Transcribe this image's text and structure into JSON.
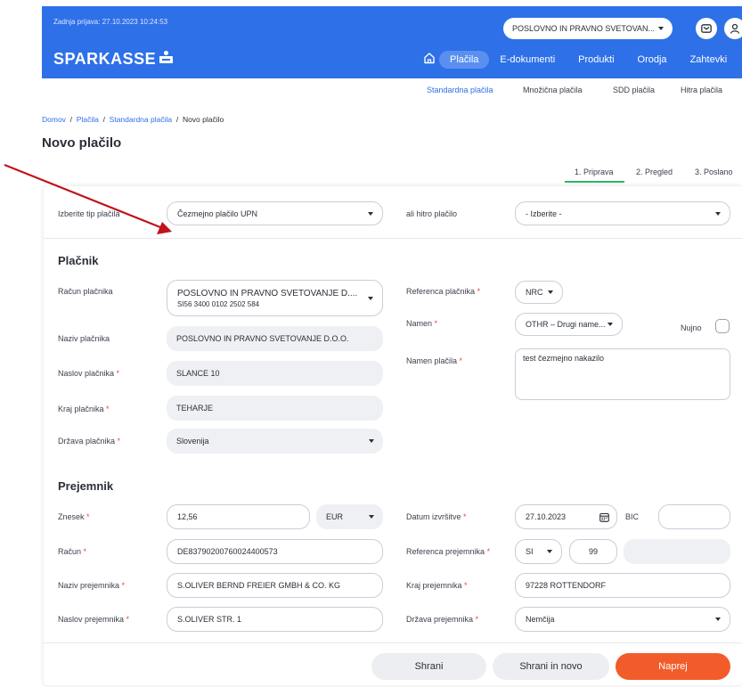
{
  "header": {
    "last_login": "Zadnja prijava: 27.10.2023 10:24:53",
    "logo": "SPARKASSE",
    "company_select": "POSLOVNO IN PRAVNO SVETOVAN...",
    "nav": [
      "Plačila",
      "E-dokumenti",
      "Produkti",
      "Orodja",
      "Zahtevki"
    ],
    "active_nav": "Plačila"
  },
  "subnav": [
    "Standardna plačila",
    "Množična plačila",
    "SDD plačila",
    "Hitra plačila"
  ],
  "breadcrumb": {
    "home": "Domov",
    "p1": "Plačila",
    "p2": "Standardna plačila",
    "current": "Novo plačilo",
    "sep": "/"
  },
  "page_title": "Novo plačilo",
  "steps": [
    "1. Priprava",
    "2. Pregled",
    "3. Poslano"
  ],
  "type_row": {
    "label": "Izberite tip plačila",
    "value": "Čezmejno plačilo UPN",
    "quick_label": "ali hitro plačilo",
    "quick_value": "- Izberite -"
  },
  "payer": {
    "section": "Plačnik",
    "account_label": "Račun plačnika",
    "account_name": "POSLOVNO IN PRAVNO SVETOVANJE D....",
    "account_iban": "SI56 3400 0102 2502 584",
    "name_label": "Naziv plačnika",
    "name_value": "POSLOVNO IN PRAVNO SVETOVANJE D.O.O.",
    "address_label": "Naslov plačnika",
    "address_value": "SLANCE 10",
    "city_label": "Kraj plačnika",
    "city_value": "TEHARJE",
    "country_label": "Država plačnika",
    "country_value": "Slovenija",
    "reference_label": "Referenca plačnika",
    "reference_value": "NRC",
    "purpose_label": "Namen",
    "purpose_value": "OTHR – Drugi name...",
    "urgent_label": "Nujno",
    "purpose_text_label": "Namen plačila",
    "purpose_text_value": "test čezmejno nakazilo"
  },
  "recipient": {
    "section": "Prejemnik",
    "amount_label": "Znesek",
    "amount_value": "12,56",
    "currency_value": "EUR",
    "date_label": "Datum izvršitve",
    "date_value": "27.10.2023",
    "bic_label": "BIC",
    "bic_value": "",
    "account_label": "Račun",
    "account_value": "DE83790200760024400573",
    "reference_label": "Referenca prejemnika",
    "reference_model": "SI",
    "reference_num": "99",
    "reference_rest": "",
    "name_label": "Naziv prejemnika",
    "name_value": "S.OLIVER BERND FREIER GMBH & CO. KG",
    "city_label": "Kraj prejemnika",
    "city_value": "97228 ROTTENDORF",
    "address_label": "Naslov prejemnika",
    "address_value": "S.OLIVER STR. 1",
    "country_label": "Država prejemnika",
    "country_value": "Nemčija"
  },
  "required_mark": "*",
  "buttons": {
    "save": "Shrani",
    "save_new": "Shrani in novo",
    "next": "Naprej"
  },
  "colors": {
    "brand": "#2e70e8",
    "primary_button": "#f25c2b",
    "required": "#e84a3a",
    "active_step": "#2fb56a",
    "annotation_arrow": "#c0141c"
  },
  "icons": [
    "home-icon",
    "mail-icon",
    "user-icon",
    "calendar-icon",
    "chevron-down-icon",
    "annotation-arrow"
  ]
}
